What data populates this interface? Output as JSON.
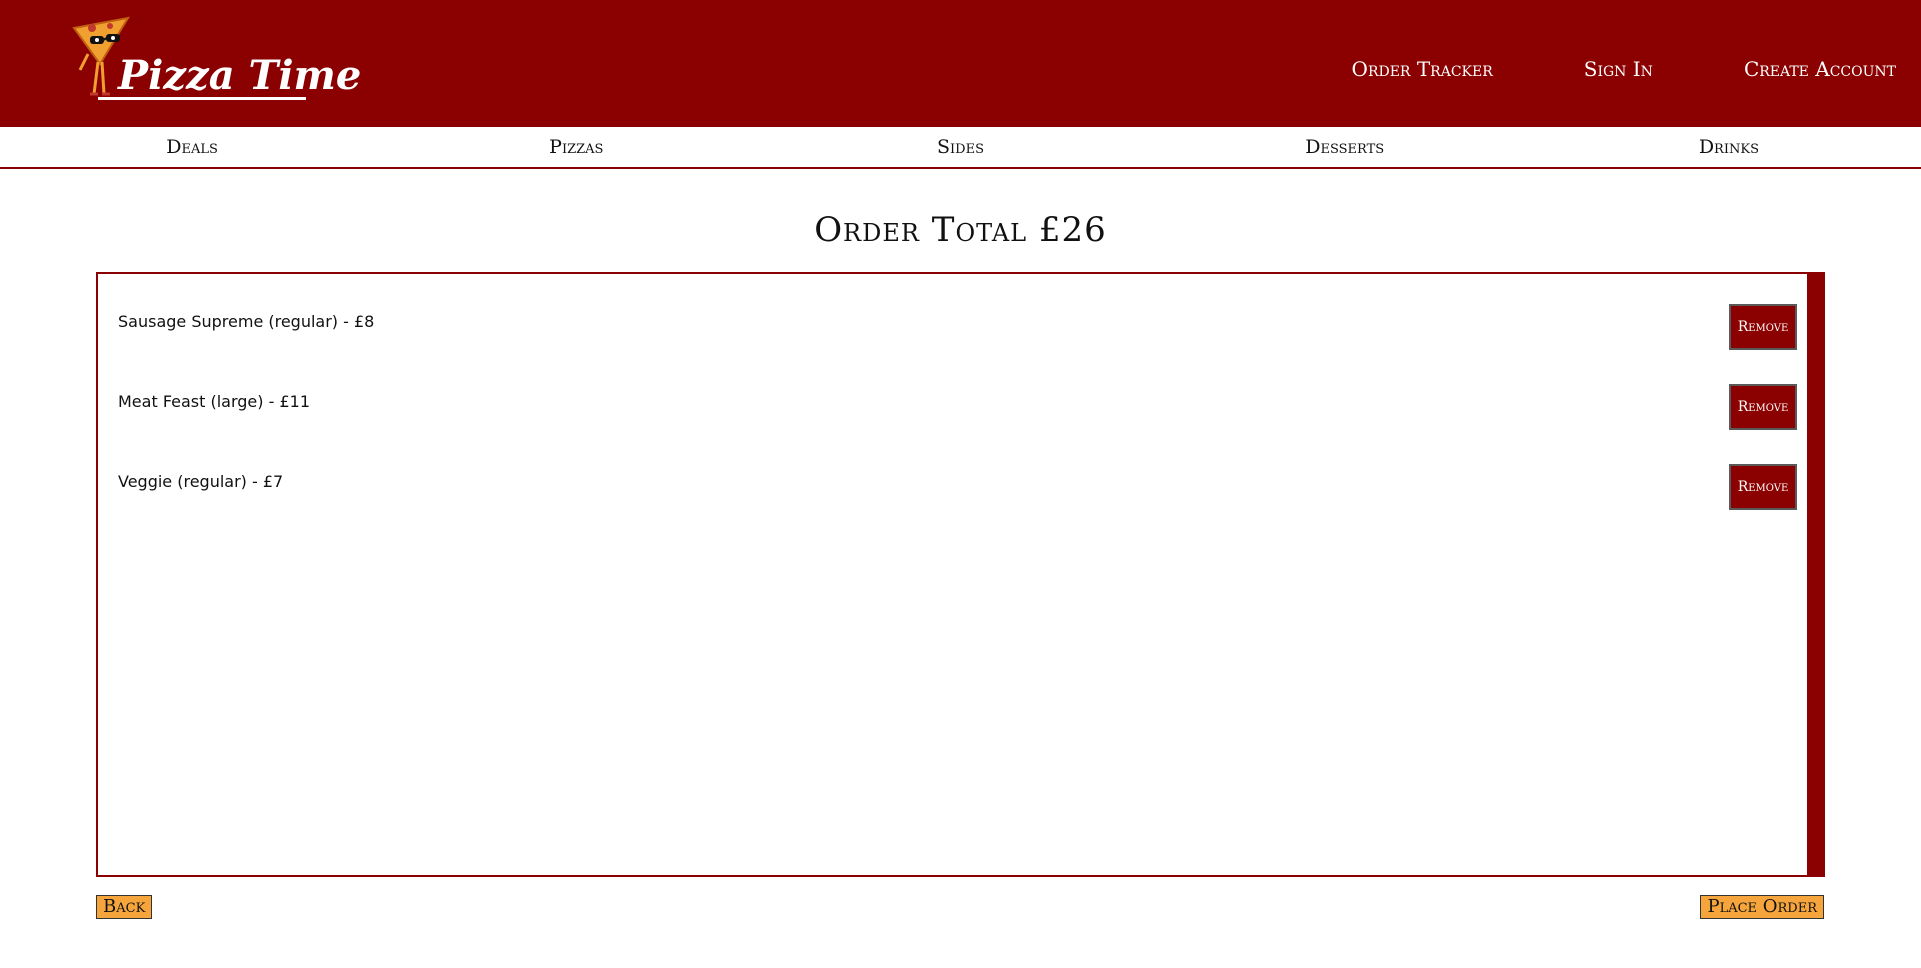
{
  "header": {
    "logo_text": "Pizza Time",
    "links": [
      "Order Tracker",
      "Sign In",
      "Create Account"
    ]
  },
  "nav": {
    "items": [
      "Deals",
      "Pizzas",
      "Sides",
      "Desserts",
      "Drinks"
    ]
  },
  "order": {
    "total_label": "Order Total £26",
    "items": [
      {
        "label": "Sausage Supreme (regular) - £8",
        "remove_label": "Remove"
      },
      {
        "label": "Meat Feast (large) - £11",
        "remove_label": "Remove"
      },
      {
        "label": "Veggie (regular) - £7",
        "remove_label": "Remove"
      }
    ]
  },
  "footer": {
    "back_label": "Back",
    "place_order_label": "Place Order"
  },
  "colors": {
    "brand_red": "#8b0000",
    "button_orange": "#f5a53c"
  },
  "icons": [
    "pizza-mascot-icon"
  ]
}
